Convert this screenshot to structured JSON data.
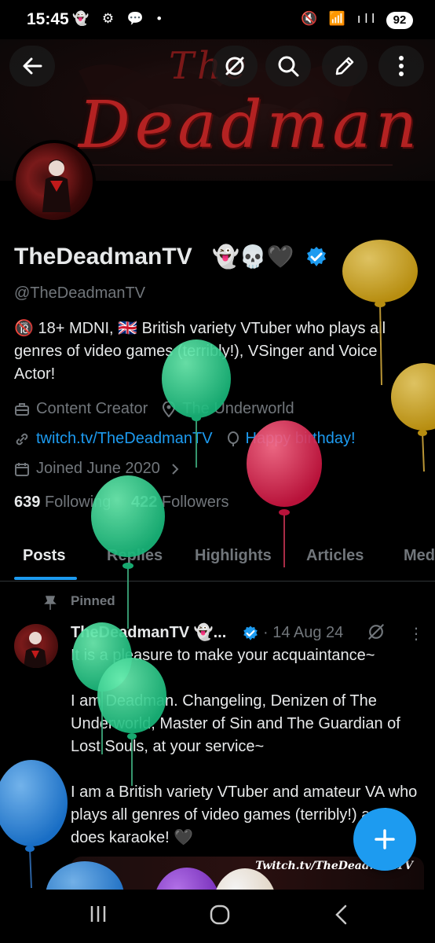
{
  "status_bar": {
    "time": "15:45",
    "left_icons": "👻 ⚙ 💬 •",
    "right_icons": "🔇 📶 ıll",
    "battery": "92"
  },
  "banner": {
    "title_word": "Deadman",
    "title_prefix": "The"
  },
  "profile": {
    "display_name": "TheDeadmanTV",
    "name_emojis": "👻💀🖤",
    "handle": "@TheDeadmanTV",
    "bio_line1": "🔞 18+ MDNI, 🇬🇧 British variety VTuber who plays all",
    "bio_line2": "genres of video games (terribly!), VSinger and Voice",
    "bio_line3": "Actor!",
    "category": "Content Creator",
    "location": "The Underworld",
    "website": "twitch.tv/TheDeadmanTV",
    "birthday": "Happy birthday!",
    "joined": "Joined June 2020",
    "following_count": "639",
    "following_label": "Following",
    "followers_count": "422",
    "followers_label": "Followers"
  },
  "tabs": [
    "Posts",
    "Replies",
    "Highlights",
    "Articles",
    "Media"
  ],
  "post": {
    "pinned_label": "Pinned",
    "author": "TheDeadmanTV 👻...",
    "date": "· 14 Aug 24",
    "more": "⋮",
    "para1": "It is a pleasure to make your acquaintance~",
    "para2": "I am Deadman. Changeling, Denizen of The Underworld, Master of Sin and The Guardian of Lost Souls, at your service~",
    "para3": "I am a British variety VTuber and amateur VA who plays all genres of video games (terribly!) and does karaoke! 🖤",
    "media_caption": "Twitch.tv/TheDeadmanTV"
  },
  "icons": {
    "back": "back-arrow-icon",
    "grok": "grok-icon",
    "search": "search-icon",
    "edit": "edit-icon",
    "more": "more-vertical-icon",
    "briefcase": "briefcase-icon",
    "location": "location-pin-icon",
    "link": "link-icon",
    "balloon": "balloon-icon",
    "calendar": "calendar-icon",
    "pin": "pin-icon",
    "compose": "plus-icon"
  },
  "colors": {
    "accent": "#1d9bf0",
    "muted": "#71767b",
    "text": "#e7e9ea",
    "background": "#000000"
  }
}
